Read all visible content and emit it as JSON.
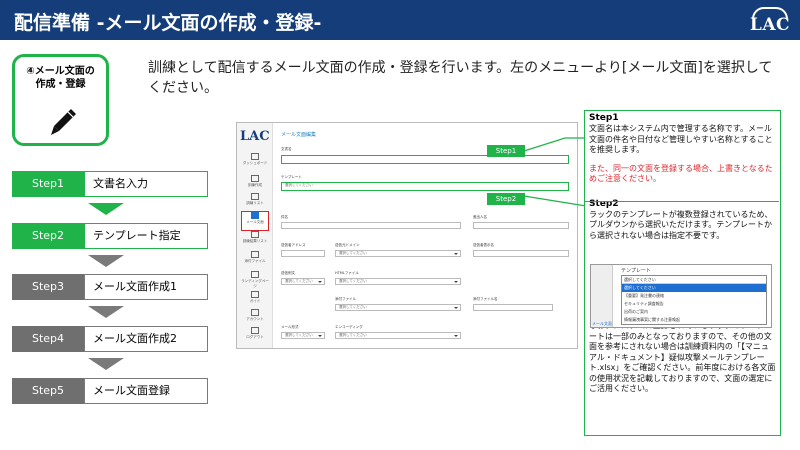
{
  "header": {
    "title": "配信準備 -メール文面の作成・登録-",
    "logo": "LAC"
  },
  "icon_box": {
    "label_line1": "④メール文面の",
    "label_line2": "作成・登録",
    "icon": "pencil-icon"
  },
  "intro": "訓練として配信するメール文面の作成・登録を行います。左のメニューより[メール文面]を選択してください。",
  "steps": [
    {
      "step": "Step1",
      "label": "文書名入力",
      "state": "active"
    },
    {
      "step": "Step2",
      "label": "テンプレート指定",
      "state": "active"
    },
    {
      "step": "Step3",
      "label": "メール文面作成1",
      "state": "inactive"
    },
    {
      "step": "Step4",
      "label": "メール文面作成2",
      "state": "inactive"
    },
    {
      "step": "Step5",
      "label": "メール文面登録",
      "state": "inactive"
    }
  ],
  "screenshot": {
    "logo": "LAC",
    "page_title": "メール文面編集",
    "nav": [
      "ダッシュボード",
      "訓練作成",
      "訓練リスト",
      "メール文面",
      "訓練結果リスト",
      "添付ファイル",
      "ランディングページ",
      "ガイド",
      "アカウント",
      "ログアウト"
    ],
    "fields": {
      "doc_name": "文書名",
      "template": "テンプレート",
      "template_placeholder": "選択してください",
      "subject": "件名",
      "sender_name": "差出人名",
      "sender_address": "送信者アドレス",
      "sender_domain": "送信元ドメイン",
      "sender_display": "送信者表示名",
      "mail_body": "送信例文",
      "html_file": "HTMLファイル",
      "attach_file": "添付ファイル",
      "attach_name": "添付ファイル名",
      "encoding_label": "メール形式",
      "encoding": "エンコーディング",
      "select_placeholder": "選択してください"
    },
    "tags": [
      "Step1",
      "Step2"
    ]
  },
  "callout": {
    "step1_title": "Step1",
    "step1_body": "文面名は本システム内で管理する名称です。メール文面の件名や日付など管理しやすい名称とすることを推奨します。",
    "step1_warning": "また、同一の文面を登録する場合、上書きとなるためご注意ください。",
    "step2_title": "Step2",
    "step2_body": "ラックのテンプレートが複数登録されているため、プルダウンから選択いただけます。テンプレートから選択されない場合は指定不要です。",
    "step2_note": "なお、システムに登録されているラックのテンプレートは一部のみとなっておりますので、その他の文面を参考にされない場合は訓練資料内の「【マニュアル・ドキュメント】疑似攻撃メールテンプレート.xlsx」をご確認ください。前年度における各文面の使用状況を記載しておりますので、文面の選定にご活用ください。"
  },
  "mini_dropdown": {
    "side_label": "メール文面",
    "label": "テンプレート",
    "options": [
      "選択してください",
      "選択してください",
      "【重要】発注書の連絡",
      "セキュリティ調査報告",
      "出荷のご案内",
      "情報漏洩事案に関する注意喚起"
    ]
  },
  "colors": {
    "header": "#143d7a",
    "accent": "#1fb34a",
    "inactive": "#6f6f6f",
    "warning": "#e0262b"
  }
}
